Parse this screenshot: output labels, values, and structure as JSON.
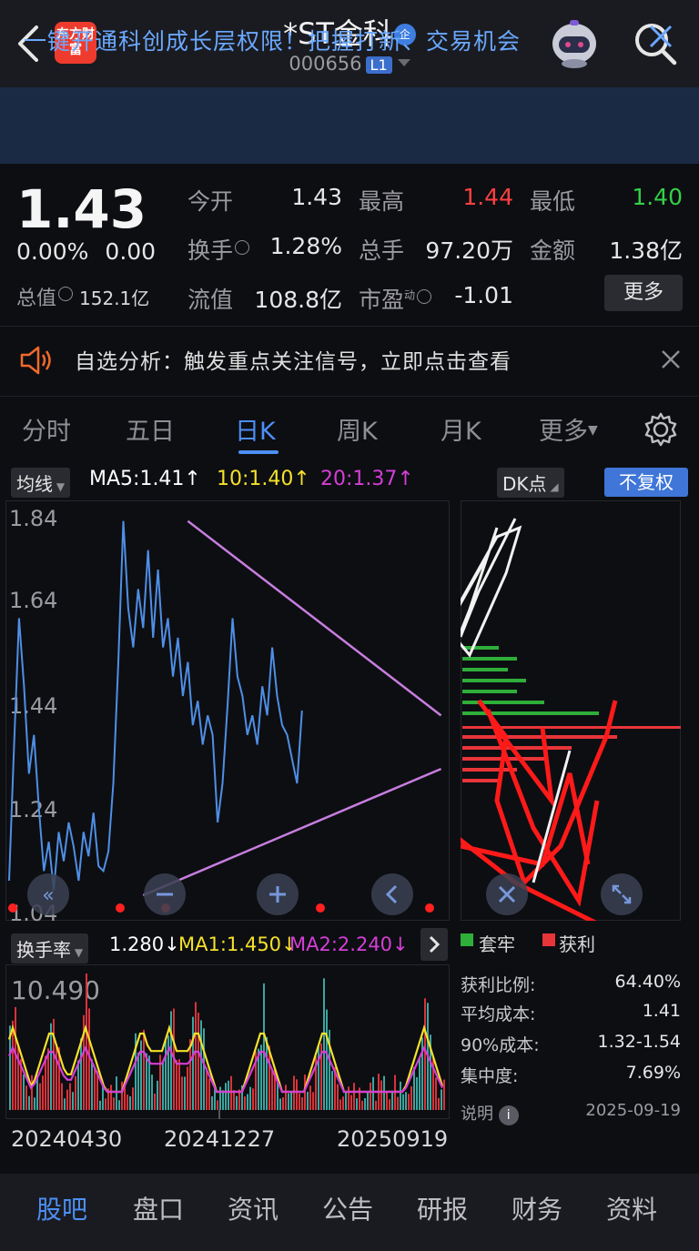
{
  "header": {
    "logo_text": "东方财富",
    "title": "*ST金科",
    "title_badge": "企",
    "code": "000656",
    "level": "L1"
  },
  "banner": {
    "text": "一键开通科创成长层权限！把握打新、交易机会"
  },
  "quote": {
    "price": "1.43",
    "change_pct": "0.00%",
    "change": "0.00",
    "market_cap_label": "总值",
    "market_cap": "152.1亿",
    "open_label": "今开",
    "open": "1.43",
    "high_label": "最高",
    "high": "1.44",
    "low_label": "最低",
    "low": "1.40",
    "turnover_label": "换手",
    "turnover": "1.28%",
    "volume_label": "总手",
    "volume": "97.20万",
    "amount_label": "金额",
    "amount": "1.38亿",
    "float_cap_label": "流值",
    "float_cap": "108.8亿",
    "pe_label": "市盈",
    "pe_sup": "动",
    "pe": "-1.01",
    "more_label": "更多"
  },
  "notice": {
    "text": "自选分析：触发重点关注信号，立即点击查看"
  },
  "tabs": [
    {
      "label": "分时"
    },
    {
      "label": "五日"
    },
    {
      "label": "日K"
    },
    {
      "label": "周K"
    },
    {
      "label": "月K"
    },
    {
      "label": "更多"
    }
  ],
  "ma_legend": {
    "chip": "均线",
    "ma5": "MA5:1.41↑",
    "ma10": "10:1.40↑",
    "ma20": "20:1.37↑",
    "dk": "DK点",
    "fuquan": "不复权"
  },
  "colors": {
    "ma5": "#ffffff",
    "ma10": "#f5e12b",
    "ma20": "#d43fd6",
    "line": "#4f8fe6",
    "trend": "#c77ee0"
  },
  "chart_data": [
    {
      "type": "line",
      "title": "",
      "y_ticks": [
        "1.84",
        "1.64",
        "1.44",
        "1.24",
        "1.04"
      ],
      "ylim": [
        1.04,
        1.86
      ],
      "x": [
        0,
        1,
        2,
        3,
        4,
        5,
        6,
        7,
        8,
        9,
        10,
        11,
        12,
        13,
        14,
        15,
        16,
        17,
        18,
        19,
        20,
        21,
        22,
        23,
        24,
        25,
        26,
        27,
        28,
        29,
        30,
        31,
        32,
        33,
        34,
        35,
        36,
        37,
        38,
        39,
        40,
        41,
        42,
        43,
        44,
        45,
        46,
        47,
        48,
        49,
        50,
        51,
        52,
        53,
        54,
        55,
        56,
        57,
        58,
        59
      ],
      "series": [
        {
          "values": [
            1.1,
            1.38,
            1.64,
            1.5,
            1.32,
            1.4,
            1.25,
            1.12,
            1.18,
            1.08,
            1.2,
            1.14,
            1.22,
            1.17,
            1.1,
            1.2,
            1.15,
            1.24,
            1.13,
            1.12,
            1.16,
            1.3,
            1.55,
            1.84,
            1.66,
            1.58,
            1.7,
            1.62,
            1.78,
            1.6,
            1.74,
            1.58,
            1.64,
            1.52,
            1.6,
            1.48,
            1.55,
            1.42,
            1.47,
            1.38,
            1.44,
            1.4,
            1.22,
            1.3,
            1.46,
            1.64,
            1.52,
            1.48,
            1.4,
            1.44,
            1.38,
            1.5,
            1.44,
            1.58,
            1.48,
            1.42,
            1.4,
            1.35,
            1.3,
            1.45
          ]
        }
      ],
      "trendlines": [
        {
          "from": [
            36,
            1.84
          ],
          "to": [
            87,
            1.44
          ]
        },
        {
          "from": [
            27,
            1.07
          ],
          "to": [
            87,
            1.33
          ]
        }
      ]
    },
    {
      "type": "bar",
      "title": "",
      "y_ticks": [
        "10.490"
      ],
      "x_labels": [
        "20240430",
        "20241227",
        "20250919"
      ],
      "legend": [
        "换手率",
        "1.280↓",
        "MA1:1.450↓",
        "MA2:2.240↓"
      ]
    }
  ],
  "chips": {
    "legend_stuck": "套牢",
    "legend_profit": "获利",
    "stats": [
      {
        "label": "获利比例:",
        "value": "64.40%"
      },
      {
        "label": "平均成本:",
        "value": "1.41"
      },
      {
        "label": "90%成本:",
        "value": "1.32-1.54"
      },
      {
        "label": "集中度:",
        "value": "7.69%"
      }
    ],
    "note_label": "说明",
    "date": "2025-09-19"
  },
  "turnover_legend": {
    "chip": "换手率",
    "val": "1.280↓",
    "ma1": "MA1:1.450↓",
    "ma2": "MA2:2.240↓",
    "ytick": "10.490",
    "x1": "20240430",
    "x2": "20241227",
    "x3": "20250919"
  },
  "bottom_nav": [
    {
      "label": "股吧"
    },
    {
      "label": "盘口"
    },
    {
      "label": "资讯"
    },
    {
      "label": "公告"
    },
    {
      "label": "研报"
    },
    {
      "label": "财务"
    },
    {
      "label": "资料"
    }
  ]
}
